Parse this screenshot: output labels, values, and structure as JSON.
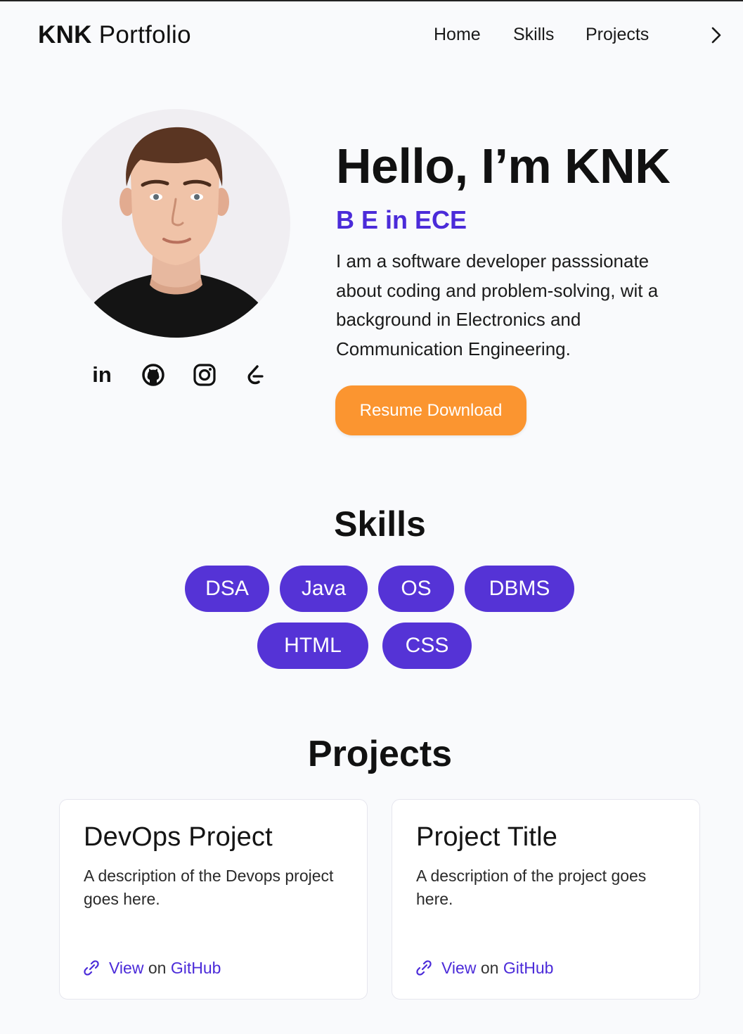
{
  "header": {
    "brand_bold": "KNK",
    "brand_rest": "Portfolio",
    "nav": [
      "Home",
      "Skills",
      "Projects"
    ],
    "next_icon": "chevron-right-icon"
  },
  "hero": {
    "avatar_icon": "profile-photo",
    "title": "Hello, I’m KNK",
    "subtitle": "B E in ECE",
    "description": "I am a software developer passsionate about coding and problem-solving, wit a background in Electronics and Communication Engineering.",
    "resume_button": "Resume Download",
    "socials": [
      "linkedin-icon",
      "github-icon",
      "instagram-icon",
      "leetcode-icon"
    ]
  },
  "skills": {
    "title": "Skills",
    "items": [
      "DSA",
      "Java",
      "OS",
      "DBMS",
      "HTML",
      "CSS"
    ]
  },
  "projects": {
    "title": "Projects",
    "cards": [
      {
        "title": "DevOps Project",
        "description": "A description of the Devops project goes here.",
        "link_view": "View",
        "link_on": "on",
        "link_github": "GitHub"
      },
      {
        "title": "Project Title",
        "description": "A description of the project goes here.",
        "link_view": "View",
        "link_on": "on",
        "link_github": "GitHub"
      }
    ]
  },
  "colors": {
    "accent": "#5533d6",
    "subtitle": "#4b2bd9",
    "resume_button": "#fb9530",
    "background": "#f9fafc"
  }
}
